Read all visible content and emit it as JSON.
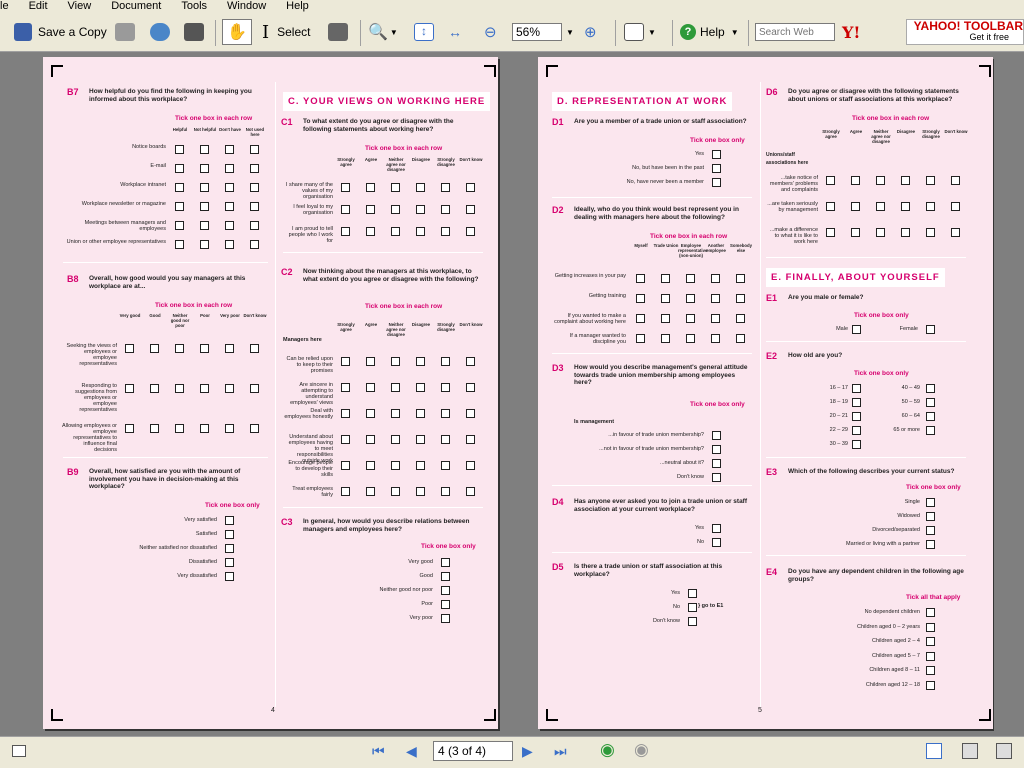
{
  "menu": [
    "le",
    "Edit",
    "View",
    "Document",
    "Tools",
    "Window",
    "Help"
  ],
  "toolbar": {
    "save_copy": "Save a Copy",
    "select": "Select",
    "zoom": "56%",
    "help": "Help",
    "search_placeholder": "Search Web",
    "yahoo_brand": "YAHOO! TOOLBAR",
    "yahoo_tag": "Get it free"
  },
  "status": {
    "page_field": "4 (3 of 4)"
  },
  "pages": {
    "left_number": "4",
    "right_number": "5"
  },
  "tick": {
    "each_row": "Tick one box in each row",
    "one_only": "Tick one box only",
    "all_apply": "Tick all that apply"
  },
  "sections": {
    "c": "C. YOUR VIEWS ON WORKING HERE",
    "d": "D. REPRESENTATION AT WORK",
    "e": "E. FINALLY, ABOUT YOURSELF"
  },
  "b7": {
    "num": "B7",
    "text": "How helpful do you find the following in keeping you informed about this workplace?",
    "cols": [
      "Helpful",
      "Not helpful",
      "Don't have",
      "Not used here"
    ],
    "rows": [
      "Notice boards",
      "E-mail",
      "Workplace intranet",
      "Workplace newsletter or magazine",
      "Meetings between managers and employees",
      "Union or other employee representatives"
    ]
  },
  "b8": {
    "num": "B8",
    "text": "Overall, how good would you say managers at this workplace are at...",
    "cols": [
      "Very good",
      "Good",
      "Neither good nor poor",
      "Poor",
      "Very poor",
      "Don't know"
    ],
    "rows": [
      "Seeking the views of employees or employee representatives",
      "Responding to suggestions from employees or employee representatives",
      "Allowing employees or employee representatives to influence final decisions"
    ]
  },
  "b9": {
    "num": "B9",
    "text": "Overall, how satisfied are you with the amount of involvement you have in decision-making at this workplace?",
    "opts": [
      "Very satisfied",
      "Satisfied",
      "Neither satisfied nor dissatisfied",
      "Dissatisfied",
      "Very dissatisfied"
    ]
  },
  "agree_cols": [
    "Strongly agree",
    "Agree",
    "Neither agree nor disagree",
    "Disagree",
    "Strongly disagree",
    "Don't know"
  ],
  "c1": {
    "num": "C1",
    "text": "To what extent do you agree or disagree with the following statements about working here?",
    "rows": [
      "I share many of the values of my organisation",
      "I feel loyal to my organisation",
      "I am proud to tell people who I work for"
    ]
  },
  "c2": {
    "num": "C2",
    "text": "Now thinking about the managers at this workplace, to what extent do you agree or disagree with the following?",
    "sub": "Managers here",
    "rows": [
      "Can be relied upon to keep to their promises",
      "Are sincere in attempting to understand employees' views",
      "Deal with employees honestly",
      "Understand about employees having to meet responsibilities outside work",
      "Encourage people to develop their skills",
      "Treat employees fairly"
    ]
  },
  "c3": {
    "num": "C3",
    "text": "In general, how would you describe relations between managers and employees here?",
    "opts": [
      "Very good",
      "Good",
      "Neither good nor poor",
      "Poor",
      "Very poor"
    ]
  },
  "d1": {
    "num": "D1",
    "text": "Are you a member of a trade union or staff association?",
    "opts": [
      "Yes",
      "No, but have been in the past",
      "No, have never been a member"
    ]
  },
  "d2": {
    "num": "D2",
    "text": "Ideally, who do you think would best represent you in dealing with managers here about the following?",
    "cols": [
      "Myself",
      "Trade Union",
      "Employee representative (non-union)",
      "Another employee",
      "Somebody else"
    ],
    "rows": [
      "Getting increases in your pay",
      "Getting training",
      "If you wanted to make a complaint about working here",
      "If a manager wanted to discipline you"
    ]
  },
  "d3": {
    "num": "D3",
    "text": "How would you describe management's general attitude towards trade union membership among employees here?",
    "sub": "Is management",
    "opts": [
      "...in favour of trade union membership?",
      "...not in favour of trade union membership?",
      "...neutral about it?",
      "Don't know"
    ]
  },
  "d4": {
    "num": "D4",
    "text": "Has anyone ever asked you to join a trade union or staff association at your current workplace?",
    "opts": [
      "Yes",
      "No"
    ]
  },
  "d5": {
    "num": "D5",
    "text": "Is there a trade union or staff association at this workplace?",
    "opts": [
      "Yes",
      "No",
      "Don't know"
    ],
    "goto": "go to E1"
  },
  "d6": {
    "num": "D6",
    "text": "Do you agree or disagree with the following statements about unions or staff associations at this workplace?",
    "sub": "Unions/staff associations here",
    "rows": [
      "...take notice of members' problems and complaints",
      "...are taken seriously by management",
      "...make a difference to what it is like to work here"
    ]
  },
  "e1": {
    "num": "E1",
    "text": "Are you male or female?",
    "opts": [
      "Male",
      "Female"
    ]
  },
  "e2": {
    "num": "E2",
    "text": "How old are you?",
    "col1": [
      "16 – 17",
      "18 – 19",
      "20 – 21",
      "22 – 29",
      "30 – 39"
    ],
    "col2": [
      "40 – 49",
      "50 – 59",
      "60 – 64",
      "65 or more"
    ]
  },
  "e3": {
    "num": "E3",
    "text": "Which of the following describes your current status?",
    "opts": [
      "Single",
      "Widowed",
      "Divorced/separated",
      "Married or living with a partner"
    ]
  },
  "e4": {
    "num": "E4",
    "text": "Do you have any dependent children in the following age groups?",
    "opts": [
      "No dependent children",
      "Children aged 0 – 2 years",
      "Children aged 2 – 4",
      "Children aged 5 – 7",
      "Children aged 8 – 11",
      "Children aged 12 – 18"
    ]
  }
}
